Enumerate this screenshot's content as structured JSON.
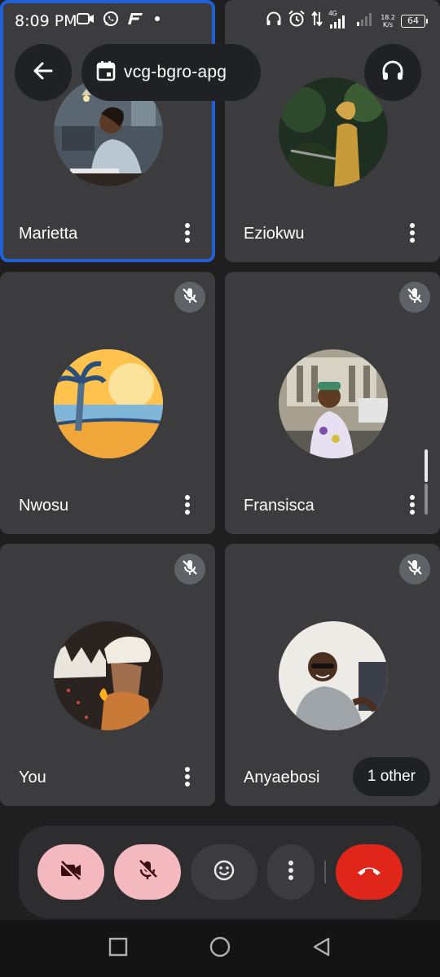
{
  "status_bar": {
    "time": "8:09 PM",
    "network_type": "4G",
    "net_speed_value": "18.2",
    "net_speed_unit": "K/s",
    "battery": "64",
    "left_icons": [
      "video-camera-icon",
      "whatsapp-icon",
      "app-notification-icon",
      "dot-icon"
    ],
    "right_icons": [
      "headphones-icon",
      "alarm-icon",
      "data-transfer-icon",
      "signal-icon",
      "signal-weak-icon"
    ]
  },
  "header": {
    "back_icon": "arrow-left-icon",
    "calendar_icon": "calendar-icon",
    "meeting_code": "vcg-bgro-apg",
    "audio_icon": "headphones-icon"
  },
  "participants": [
    {
      "name": "Marietta",
      "active_speaker": true,
      "muted": false
    },
    {
      "name": "Eziokwu",
      "active_speaker": false,
      "muted": false
    },
    {
      "name": "Nwosu",
      "active_speaker": false,
      "muted": true
    },
    {
      "name": "Fransisca",
      "active_speaker": false,
      "muted": true
    },
    {
      "name": "You",
      "active_speaker": false,
      "muted": true
    },
    {
      "name": "Anyaebosi",
      "active_speaker": false,
      "muted": true,
      "extra": "1 other"
    }
  ],
  "controls": {
    "camera": "camera-off-icon",
    "mic": "mic-off-icon",
    "reactions": "emoji-icon",
    "more": "more-vert-icon",
    "end_call": "end-call-icon"
  },
  "colors": {
    "tile_bg": "#3c3c3e",
    "active_outline": "#1f5fd6",
    "toggle_off_bg": "#f4b8bf",
    "end_call_bg": "#e0251b"
  },
  "nav": [
    "recent-apps-icon",
    "home-icon",
    "back-icon"
  ]
}
